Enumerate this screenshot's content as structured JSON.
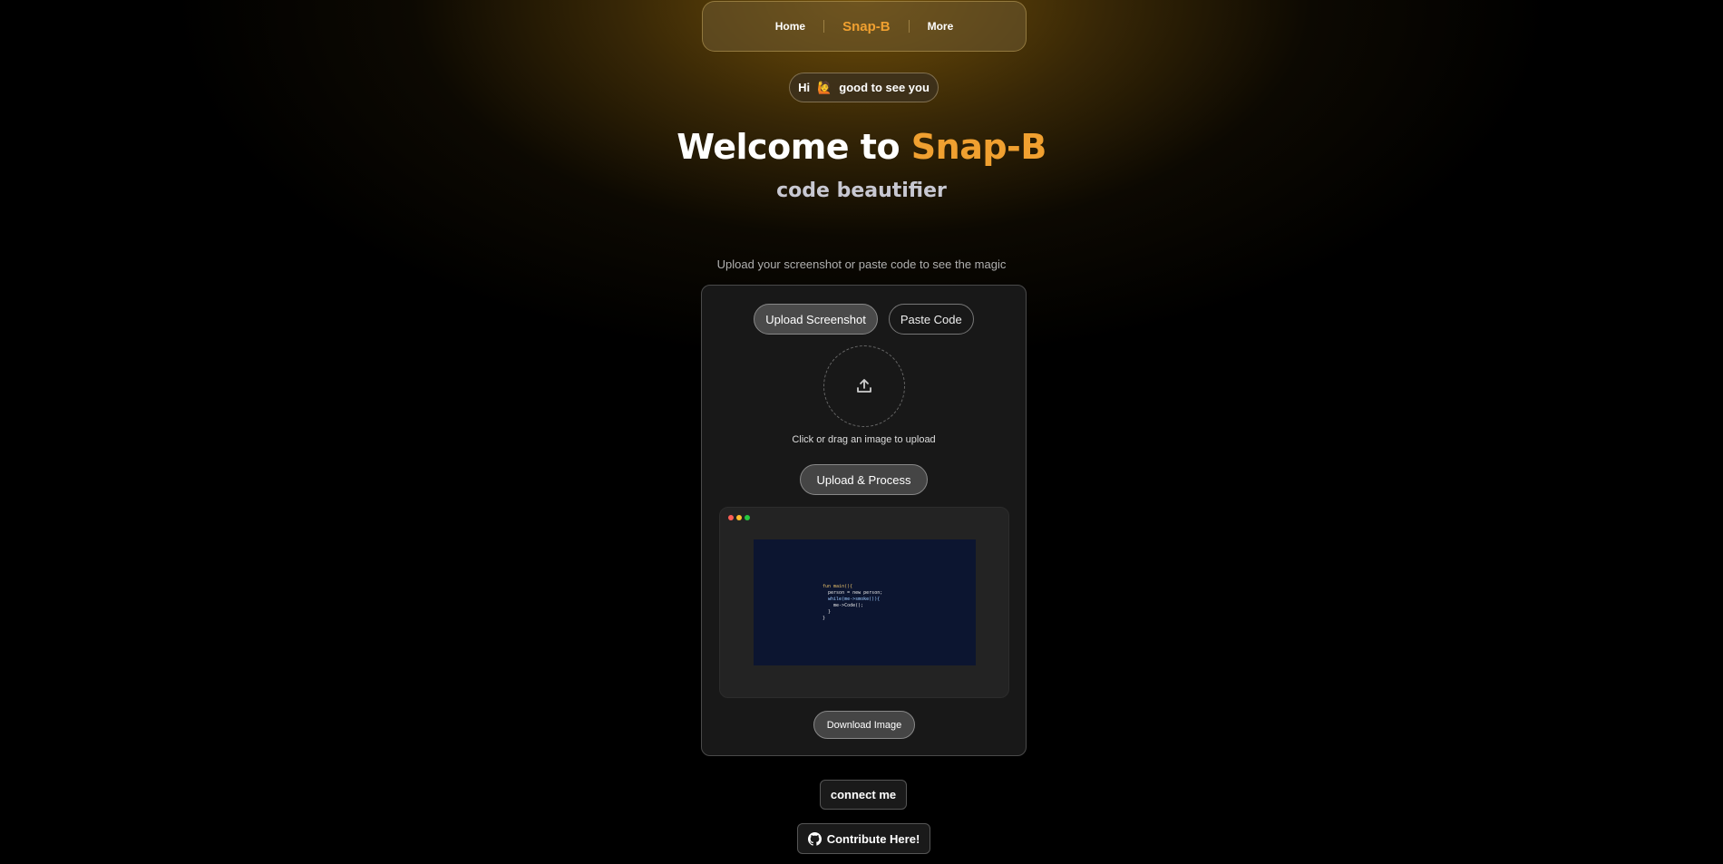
{
  "nav": {
    "home_label": "Home",
    "brand_label": "Snap-B",
    "more_label": "More"
  },
  "greeting": {
    "hi": "Hi",
    "wave_emoji": "🙋",
    "text": "good to see you"
  },
  "hero": {
    "title_prefix": "Welcome to",
    "title_brand": "Snap-B",
    "subtitle": "code beautifier"
  },
  "instructions": "Upload your screenshot or paste code to see the magic",
  "card": {
    "tabs": [
      {
        "label": "Upload Screenshot",
        "active": true
      },
      {
        "label": "Paste Code",
        "active": false
      }
    ],
    "upload_icon": "upload-icon",
    "drop_hint": "Click or drag an image to upload",
    "process_label": "Upload & Process",
    "preview": {
      "window_dots": [
        "#ff5f56",
        "#ffbd2e",
        "#27c93f"
      ],
      "code_lines": [
        "fun main(){",
        "  person = new person;",
        "  while(me->smoke()){",
        "    me->Code();",
        "  }",
        "}"
      ]
    },
    "download_label": "Download Image"
  },
  "footer": {
    "connect_label": "connect me",
    "contribute_label": "Contribute Here!",
    "contribute_icon": "github-icon"
  },
  "colors": {
    "brand": "#f0a030",
    "code_bg": "#0c1530"
  }
}
